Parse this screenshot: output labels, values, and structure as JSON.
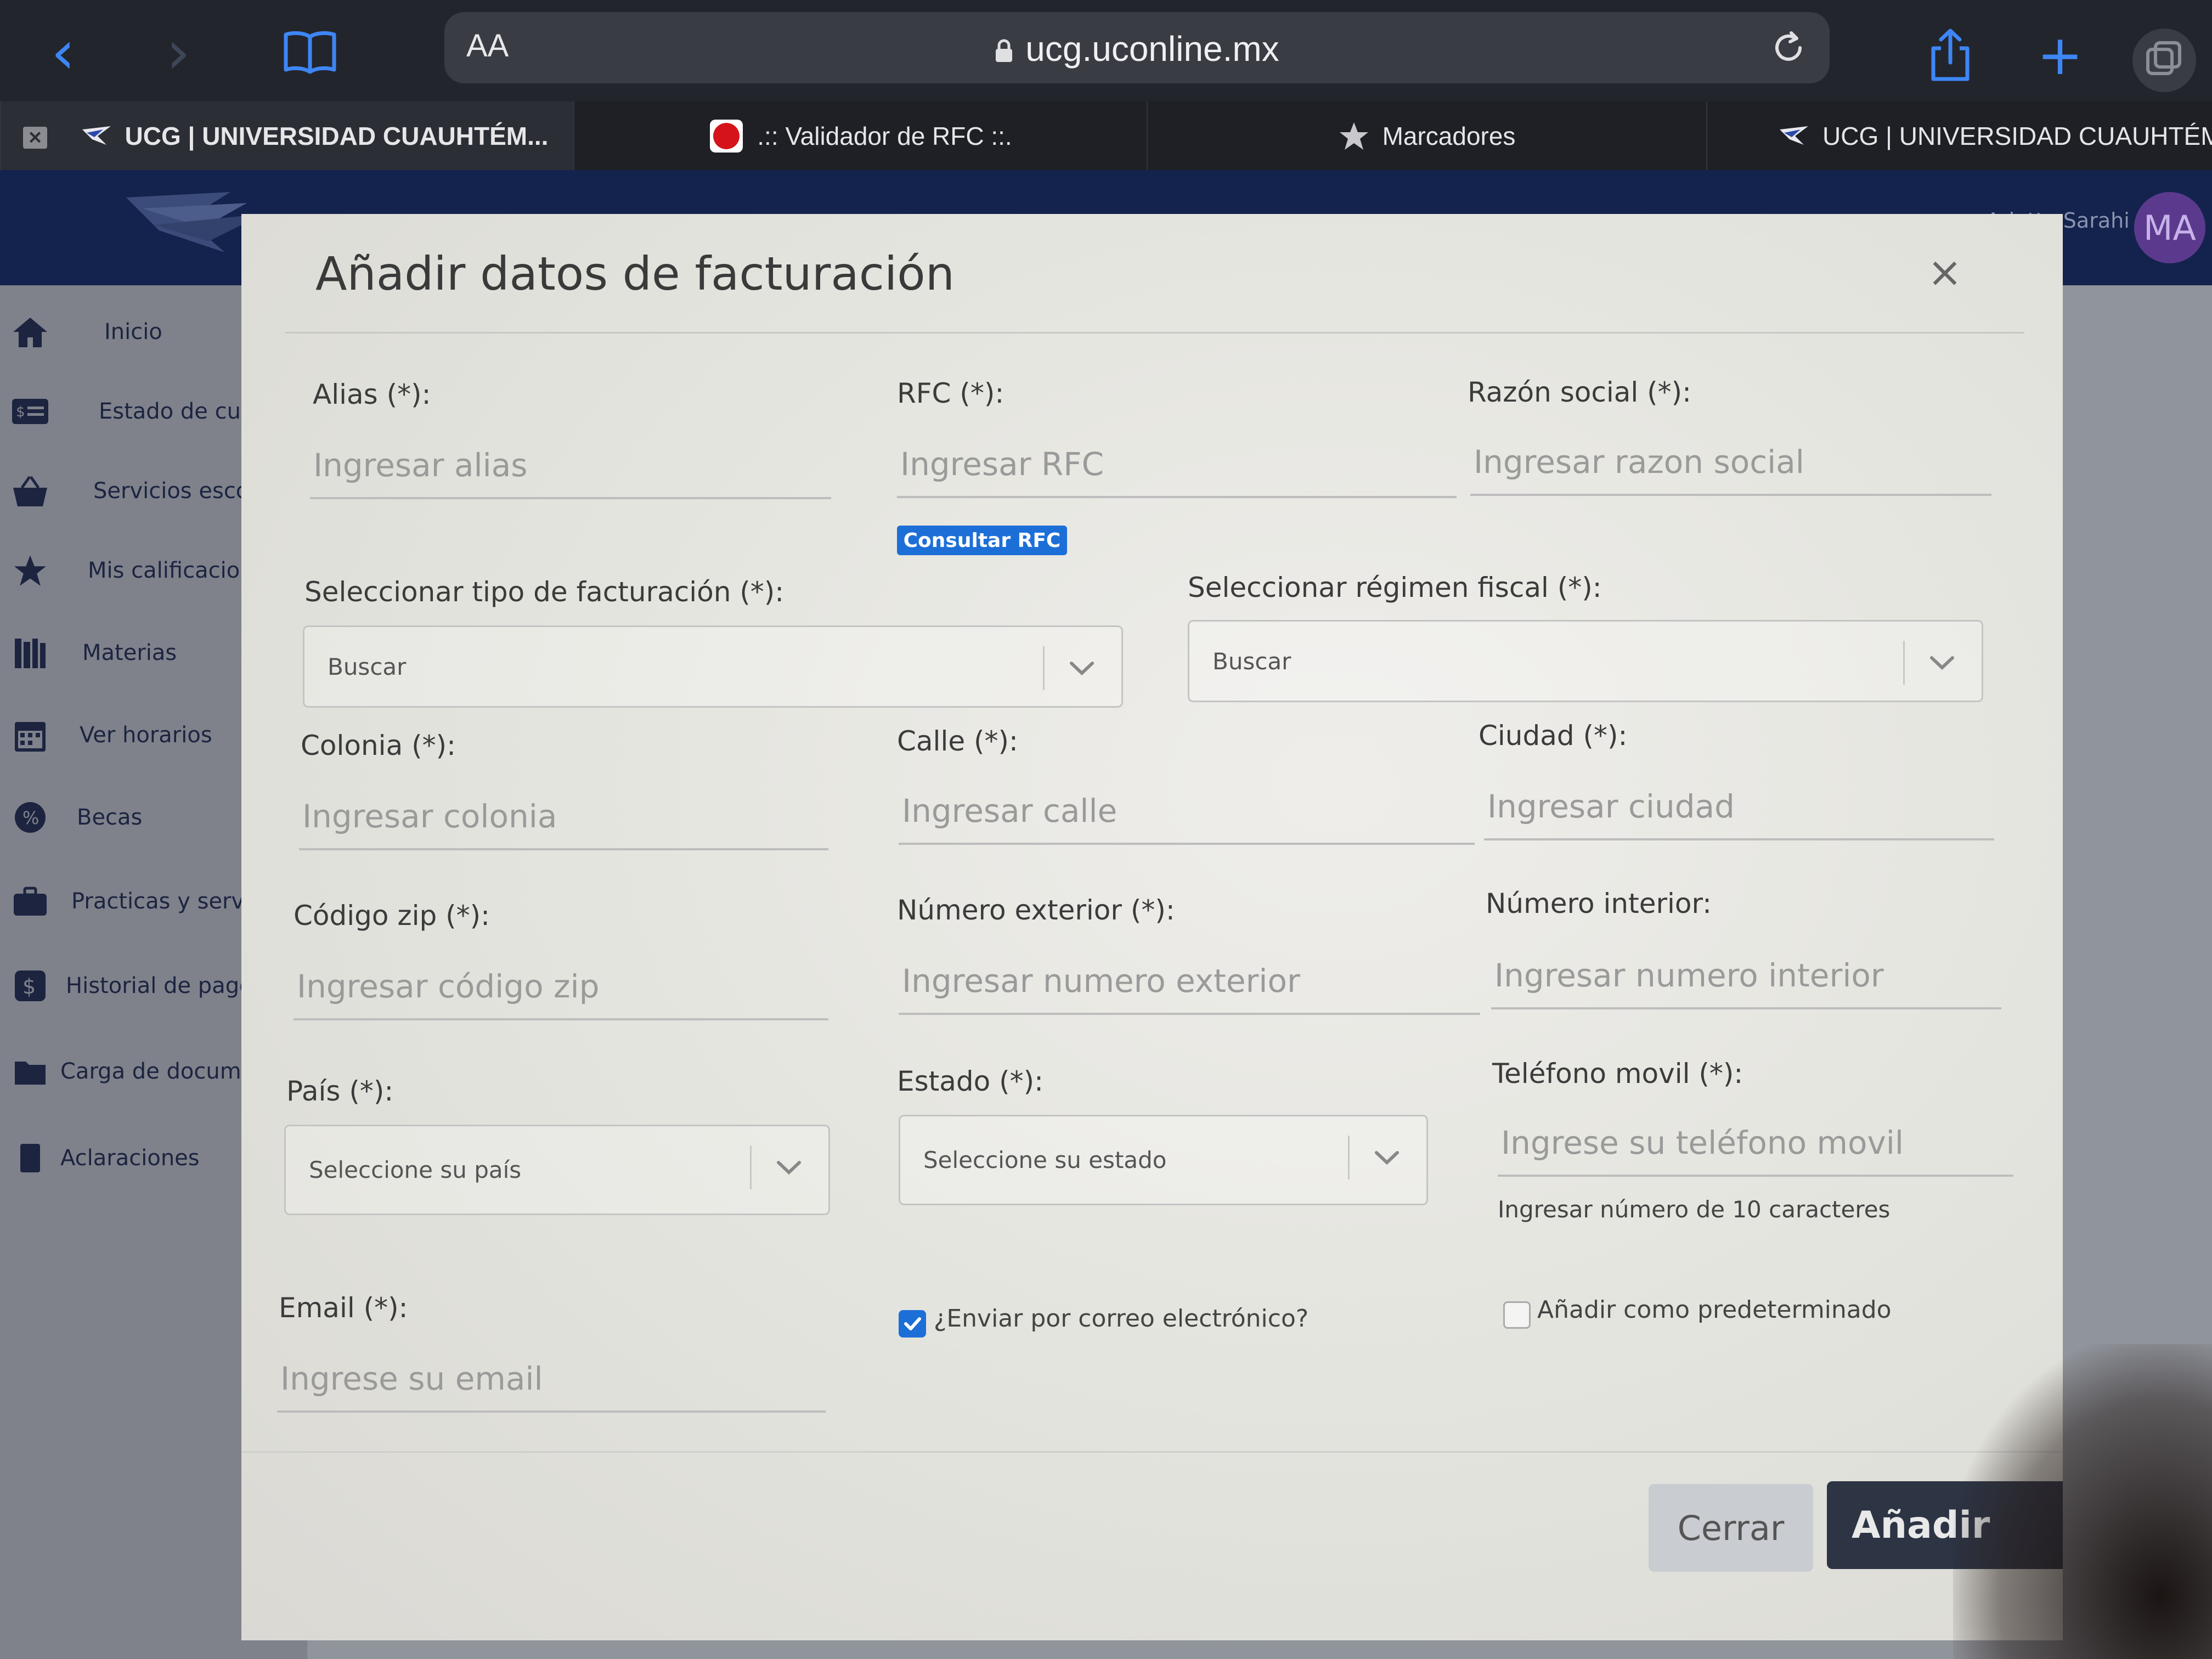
{
  "browser": {
    "aa_label": "AA",
    "url": "ucg.uconline.mx",
    "tabs": [
      {
        "label": "UCG | UNIVERSIDAD CUAUHTÉM..."
      },
      {
        "label": ".:: Validador de RFC ::."
      },
      {
        "label": "Marcadores"
      },
      {
        "label": "UCG | UNIVERSIDAD CUAUHTÉM..."
      }
    ],
    "close_tab_glyph": "✕",
    "accent": "#3e86f5"
  },
  "app": {
    "user_name": "Arlette Sarahi",
    "avatar_initials": "MA",
    "sidebar": [
      {
        "label": "Inicio",
        "icon": "home-icon"
      },
      {
        "label": "Estado de cuenta",
        "icon": "billing-icon"
      },
      {
        "label": "Servicios escolares",
        "icon": "basket-icon"
      },
      {
        "label": "Mis calificaciones",
        "icon": "star-icon"
      },
      {
        "label": "Materias",
        "icon": "books-icon"
      },
      {
        "label": "Ver horarios",
        "icon": "calendar-icon"
      },
      {
        "label": "Becas",
        "icon": "badge-icon"
      },
      {
        "label": "Practicas y servicio",
        "icon": "briefcase-icon"
      },
      {
        "label": "Historial de pago",
        "icon": "dollar-icon"
      },
      {
        "label": "Carga de documentos",
        "icon": "folder-icon"
      },
      {
        "label": "Aclaraciones",
        "icon": "doc-icon"
      }
    ]
  },
  "modal": {
    "title": "Añadir datos de facturación",
    "close_glyph": "×",
    "fields": {
      "alias": {
        "label": "Alias (*):",
        "placeholder": "Ingresar alias"
      },
      "rfc": {
        "label": "RFC (*):",
        "placeholder": "Ingresar RFC",
        "button": "Consultar RFC"
      },
      "razon_social": {
        "label": "Razón social (*):",
        "placeholder": "Ingresar razon social"
      },
      "tipo_facturacion": {
        "label": "Seleccionar tipo de facturación (*):",
        "value": "Buscar"
      },
      "regimen_fiscal": {
        "label": "Seleccionar régimen fiscal (*):",
        "value": "Buscar"
      },
      "colonia": {
        "label": "Colonia (*):",
        "placeholder": "Ingresar colonia"
      },
      "calle": {
        "label": "Calle (*):",
        "placeholder": "Ingresar calle"
      },
      "ciudad": {
        "label": "Ciudad (*):",
        "placeholder": "Ingresar ciudad"
      },
      "codigo_zip": {
        "label": "Código zip (*):",
        "placeholder": "Ingresar código zip"
      },
      "numero_exterior": {
        "label": "Número exterior (*):",
        "placeholder": "Ingresar numero exterior"
      },
      "numero_interior": {
        "label": "Número interior:",
        "placeholder": "Ingresar numero interior"
      },
      "pais": {
        "label": "País (*):",
        "value": "Seleccione su país"
      },
      "estado": {
        "label": "Estado (*):",
        "value": "Seleccione su estado"
      },
      "telefono": {
        "label": "Teléfono movil (*):",
        "placeholder": "Ingrese su teléfono movil",
        "hint": "Ingresar número de 10 caracteres"
      },
      "email": {
        "label": "Email (*):",
        "placeholder": "Ingrese su email"
      }
    },
    "checkboxes": {
      "enviar_correo": {
        "label": "¿Enviar por correo electrónico?",
        "checked": true
      },
      "predeterminado": {
        "label": "Añadir como predeterminado",
        "checked": false
      }
    },
    "buttons": {
      "cerrar": "Cerrar",
      "anadir": "Añadir"
    },
    "colors": {
      "primary": "#1d6fd8",
      "dark_button": "#2d3444",
      "header": "#14234d"
    }
  }
}
